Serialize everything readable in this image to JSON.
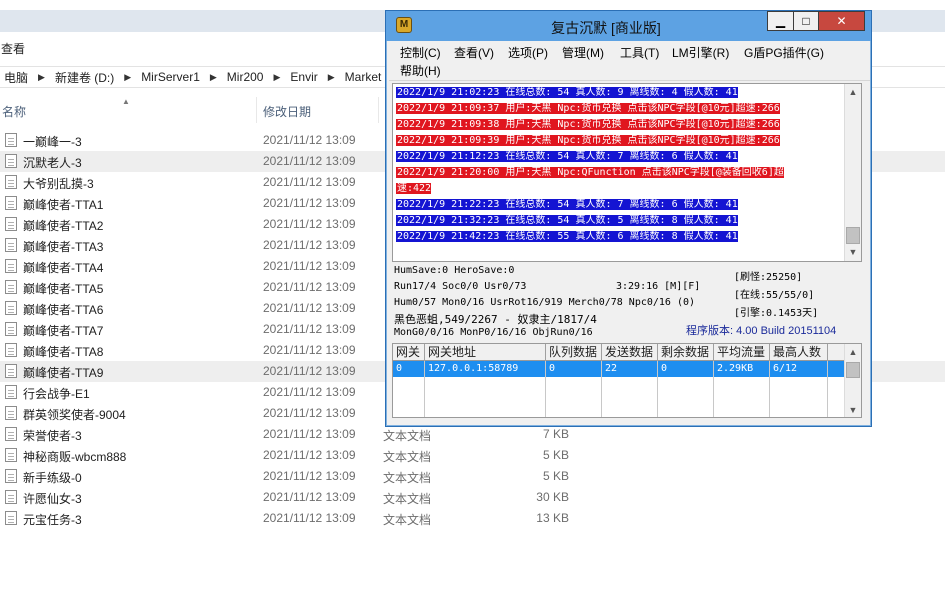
{
  "explorer": {
    "menu_view": "查看",
    "breadcrumb": [
      "电脑",
      "新建卷 (D:)",
      "MirServer1",
      "Mir200",
      "Envir",
      "Market"
    ],
    "columns": {
      "name": "名称",
      "date": "修改日期"
    },
    "files": [
      {
        "name": "一巅峰一-3",
        "date": "2021/11/12 13:09",
        "type": "",
        "size": ""
      },
      {
        "name": "沉默老人-3",
        "date": "2021/11/12 13:09",
        "type": "",
        "size": ""
      },
      {
        "name": "大爷别乱摸-3",
        "date": "2021/11/12 13:09",
        "type": "",
        "size": ""
      },
      {
        "name": "巅峰使者-TTA1",
        "date": "2021/11/12 13:09",
        "type": "",
        "size": ""
      },
      {
        "name": "巅峰使者-TTA2",
        "date": "2021/11/12 13:09",
        "type": "",
        "size": ""
      },
      {
        "name": "巅峰使者-TTA3",
        "date": "2021/11/12 13:09",
        "type": "",
        "size": ""
      },
      {
        "name": "巅峰使者-TTA4",
        "date": "2021/11/12 13:09",
        "type": "",
        "size": ""
      },
      {
        "name": "巅峰使者-TTA5",
        "date": "2021/11/12 13:09",
        "type": "",
        "size": ""
      },
      {
        "name": "巅峰使者-TTA6",
        "date": "2021/11/12 13:09",
        "type": "",
        "size": ""
      },
      {
        "name": "巅峰使者-TTA7",
        "date": "2021/11/12 13:09",
        "type": "",
        "size": ""
      },
      {
        "name": "巅峰使者-TTA8",
        "date": "2021/11/12 13:09",
        "type": "",
        "size": ""
      },
      {
        "name": "巅峰使者-TTA9",
        "date": "2021/11/12 13:09",
        "type": "",
        "size": ""
      },
      {
        "name": "行会战争-E1",
        "date": "2021/11/12 13:09",
        "type": "",
        "size": ""
      },
      {
        "name": "群英领奖使者-9004",
        "date": "2021/11/12 13:09",
        "type": "",
        "size": ""
      },
      {
        "name": "荣誉使者-3",
        "date": "2021/11/12 13:09",
        "type": "文本文档",
        "size": "7 KB"
      },
      {
        "name": "神秘商贩-wbcm888",
        "date": "2021/11/12 13:09",
        "type": "文本文档",
        "size": "5 KB"
      },
      {
        "name": "新手练级-0",
        "date": "2021/11/12 13:09",
        "type": "文本文档",
        "size": "5 KB"
      },
      {
        "name": "许愿仙女-3",
        "date": "2021/11/12 13:09",
        "type": "文本文档",
        "size": "30 KB"
      },
      {
        "name": "元宝任务-3",
        "date": "2021/11/12 13:09",
        "type": "文本文档",
        "size": "13 KB"
      }
    ]
  },
  "mir": {
    "title": "复古沉默 [商业版]",
    "window_buttons": {
      "min": "▁",
      "max": "□",
      "close": "✕"
    },
    "menu": [
      "控制(C)",
      "查看(V)",
      "选项(P)",
      "管理(M)",
      "工具(T)",
      "LM引擎(R)",
      "G盾PG插件(G)",
      "帮助(H)"
    ],
    "log": [
      {
        "text": "2022/1/9 21:02:23 在线总数: 54 真人数: 9 离线数: 4 假人数: 41",
        "color": "blue"
      },
      {
        "text": "2022/1/9 21:09:37 用户:天黑 Npc:货币兑换 点击该NPC字段[@10元]超速:266",
        "color": "red"
      },
      {
        "text": "2022/1/9 21:09:38 用户:天黑 Npc:货币兑换 点击该NPC字段[@10元]超速:266",
        "color": "red"
      },
      {
        "text": "2022/1/9 21:09:39 用户:天黑 Npc:货币兑换 点击该NPC字段[@10元]超速:266",
        "color": "red"
      },
      {
        "text": "2022/1/9 21:12:23 在线总数: 54 真人数: 7 离线数: 6 假人数: 41",
        "color": "blue"
      },
      {
        "text": "2022/1/9 21:20:00 用户:天黑 Npc:QFunction 点击该NPC字段[@装备回收6]超",
        "color": "red"
      },
      {
        "text": "速:422",
        "color": "red"
      },
      {
        "text": "2022/1/9 21:22:23 在线总数: 54 真人数: 7 离线数: 6 假人数: 41",
        "color": "blue"
      },
      {
        "text": "2022/1/9 21:32:23 在线总数: 54 真人数: 5 离线数: 8 假人数: 41",
        "color": "blue"
      },
      {
        "text": "2022/1/9 21:42:23 在线总数: 55 真人数: 6 离线数: 8 假人数: 41",
        "color": "blue"
      }
    ],
    "status": {
      "line1": "HumSave:0 HeroSave:0",
      "line2": "Run17/4 Soc0/0 Usr0/73",
      "time": "3:29:16 [M][F]",
      "line3": "Hum0/57 Mon0/16 UsrRot16/919 Merch0/78 Npc0/16 (0)",
      "line4": "黑色恶蛆,549/2267 - 奴隶主/1817/4",
      "line5": "MonG0/0/16 MonP0/16/16 ObjRun0/16",
      "refresh": "[刷怪:25250]",
      "online": "[在线:55/55/0]",
      "engine": "[引擎:0.1453天]",
      "version": "程序版本: 4.00 Build 20151104"
    },
    "gateway": {
      "headers": [
        "网关",
        "网关地址",
        "队列数据",
        "发送数据",
        "剩余数据",
        "平均流量",
        "最高人数"
      ],
      "rows": [
        [
          "0",
          "127.0.0.1:58789",
          "0",
          "22",
          "0",
          "2.29KB",
          "6/12"
        ]
      ]
    }
  }
}
